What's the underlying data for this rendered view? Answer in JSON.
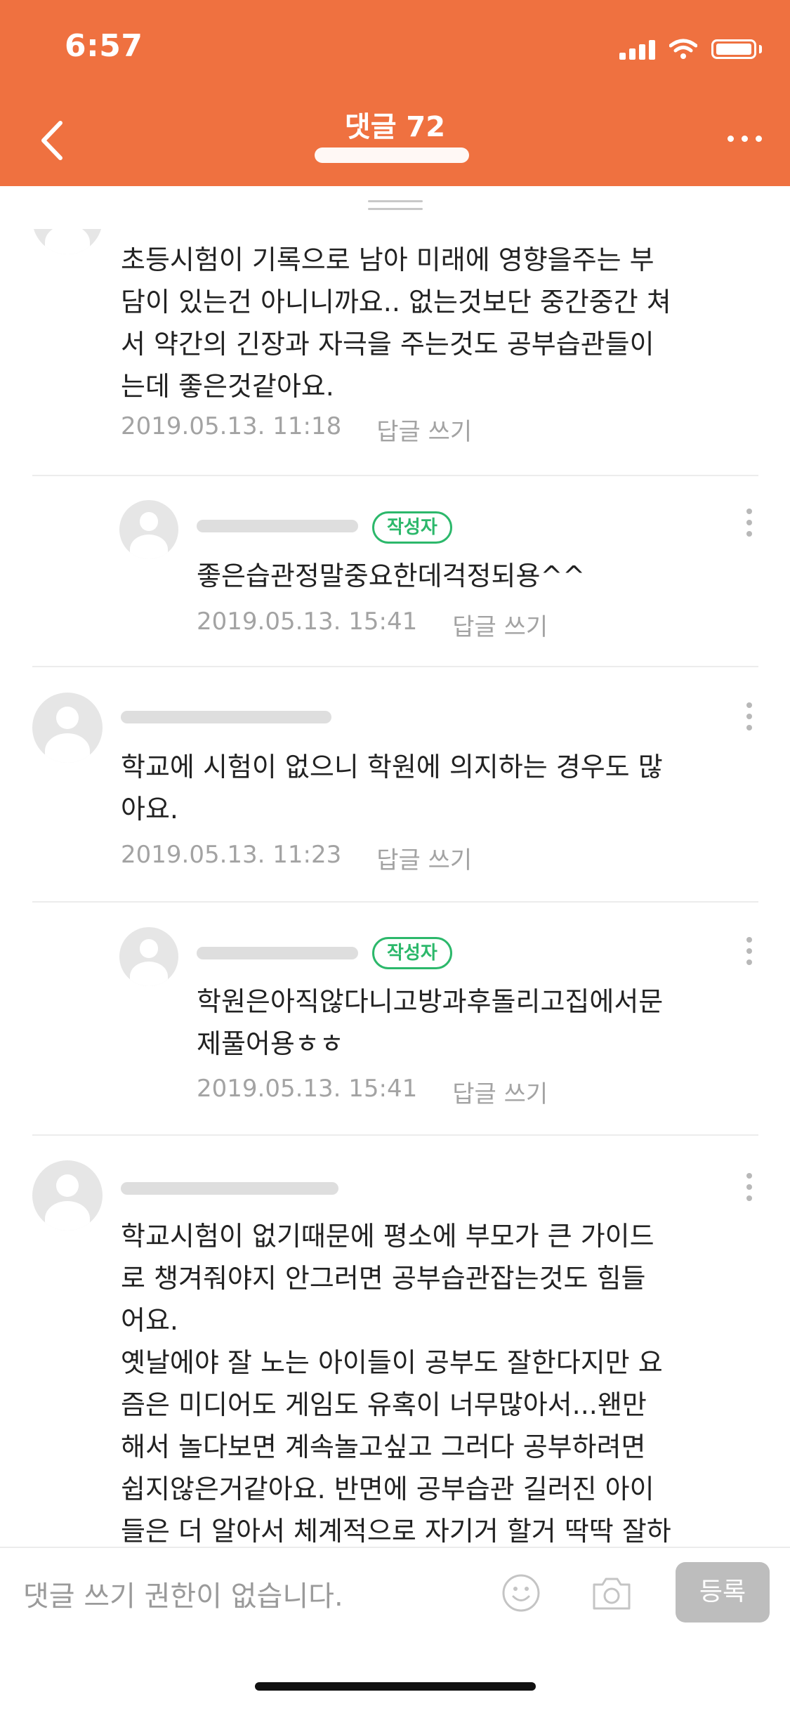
{
  "status_bar": {
    "time": "6:57"
  },
  "header": {
    "title": "댓글 72",
    "subtitle": ""
  },
  "comments": [
    {
      "text": "초등시험이 기록으로 남아 미래에 영향을주는 부\n담이 있는건 아니니까요.. 없는것보단 중간중간 쳐\n서 약간의 긴장과 자극을 주는것도 공부습관들이\n는데 좋은것같아요.",
      "date": "2019.05.13. 11:18",
      "reply_label": "답글 쓰기"
    },
    {
      "is_reply": true,
      "badge": "작성자",
      "text": "좋은습관정말중요한데걱정되용^^",
      "date": "2019.05.13. 15:41",
      "reply_label": "답글 쓰기"
    },
    {
      "text": "학교에 시험이 없으니 학원에 의지하는 경우도 많\n아요.",
      "date": "2019.05.13. 11:23",
      "reply_label": "답글 쓰기"
    },
    {
      "is_reply": true,
      "badge": "작성자",
      "text": "학원은아직않다니고방과후돌리고집에서문\n제풀어용ㅎㅎ",
      "date": "2019.05.13. 15:41",
      "reply_label": "답글 쓰기"
    },
    {
      "text": "학교시험이 없기때문에 평소에 부모가 큰 가이드\n로 챙겨줘야지 안그러면 공부습관잡는것도 힘들\n어요.\n옛날에야 잘 노는 아이들이 공부도 잘한다지만 요\n즘은 미디어도 게임도 유혹이 너무많아서...왠만\n해서 놀다보면 계속놀고싶고 그러다 공부하려면\n쉽지않은거같아요. 반면에 공부습관 길러진 아이\n들은 더 알아서 체계적으로 자기거 할거 딱딱 잘하"
    }
  ],
  "input": {
    "placeholder": "댓글 쓰기 권한이 없습니다.",
    "submit_label": "등록"
  },
  "colors": {
    "header": "#ef7140",
    "badge": "#2cb86b",
    "meta": "#a3a3a3"
  }
}
